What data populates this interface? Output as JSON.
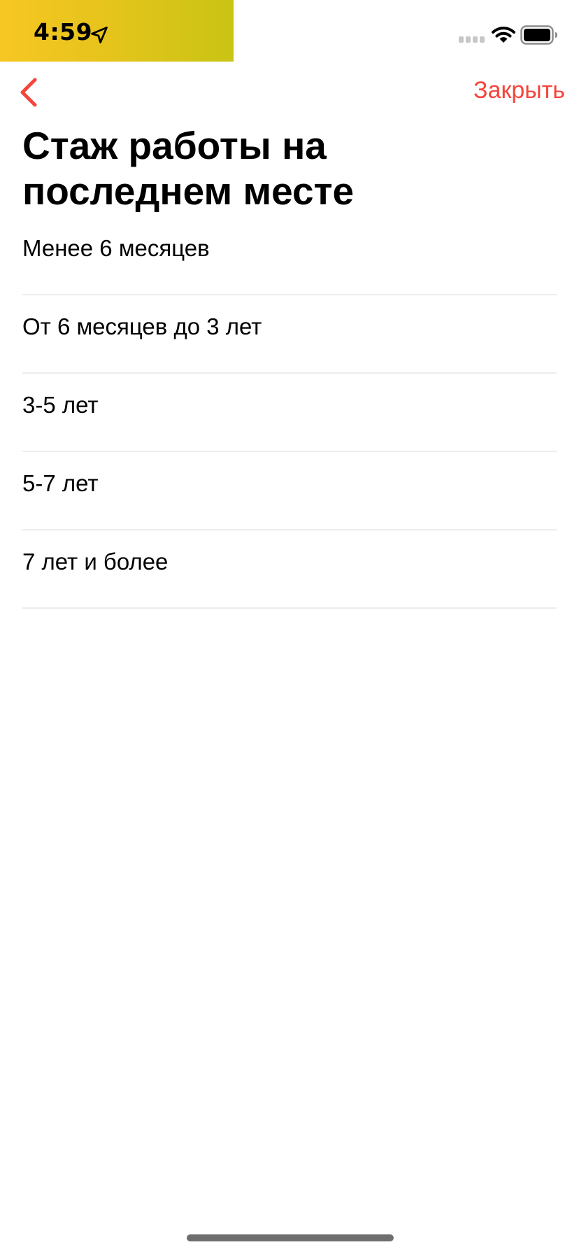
{
  "status_bar": {
    "time": "4:59",
    "location_icon": "location-arrow-icon",
    "signal_icon": "cellular-signal-icon",
    "wifi_icon": "wifi-icon",
    "battery_icon": "battery-icon",
    "time_pill_colors": [
      "#f7c623",
      "#c9c414"
    ]
  },
  "nav": {
    "back_icon": "chevron-left-icon",
    "close_label": "Закрыть",
    "accent_color": "#f5453c"
  },
  "title": "Стаж работы на последнем месте",
  "options": [
    {
      "label": "Менее 6 месяцев"
    },
    {
      "label": "От 6 месяцев до 3 лет"
    },
    {
      "label": "3-5 лет"
    },
    {
      "label": "5-7 лет"
    },
    {
      "label": "7 лет и более"
    }
  ]
}
